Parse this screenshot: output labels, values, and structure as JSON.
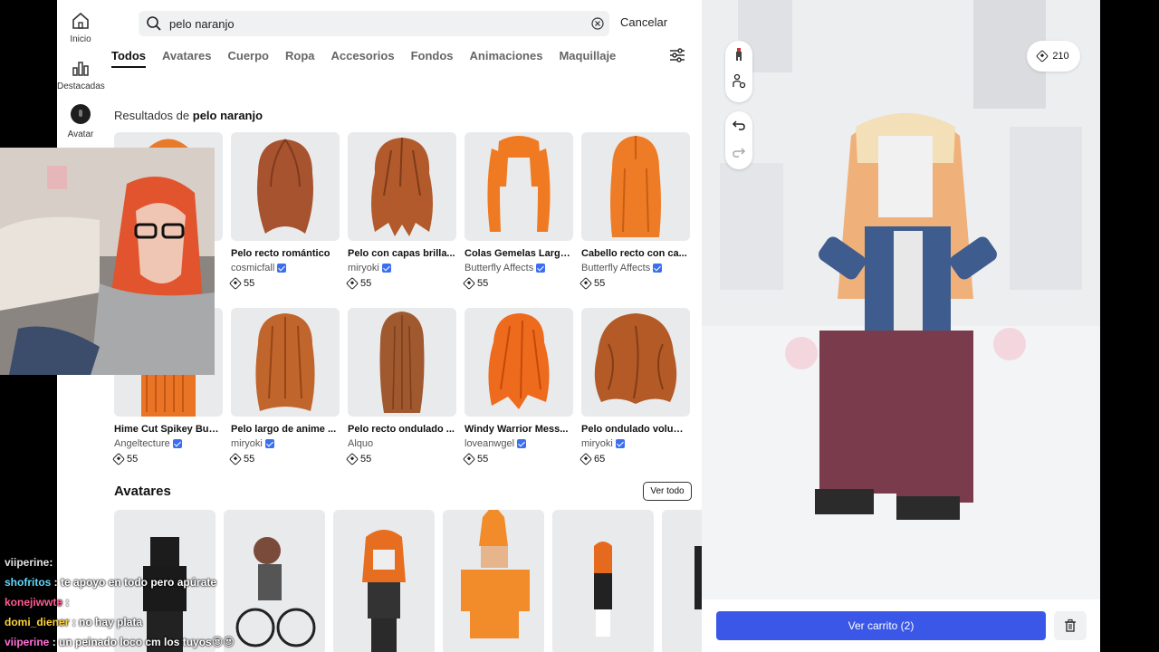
{
  "rail": {
    "items": [
      {
        "label": "Inicio",
        "icon": "home-icon"
      },
      {
        "label": "Destacadas",
        "icon": "chart-icon"
      },
      {
        "label": "Avatar",
        "icon": "avatar-icon"
      }
    ]
  },
  "search": {
    "value": "pelo naranjo",
    "cancel_label": "Cancelar"
  },
  "tabs": [
    "Todos",
    "Avatares",
    "Cuerpo",
    "Ropa",
    "Accesorios",
    "Fondos",
    "Animaciones",
    "Maquillaje"
  ],
  "active_tab": "Todos",
  "results": {
    "prefix": "Resultados de",
    "query": "pelo naranjo"
  },
  "items": [
    {
      "name": "",
      "creator": "",
      "price": ""
    },
    {
      "name": "Pelo recto romántico",
      "creator": "cosmicfall",
      "price": "55"
    },
    {
      "name": "Pelo con capas brilla...",
      "creator": "miryoki",
      "price": "55"
    },
    {
      "name": "Colas Gemelas Larga...",
      "creator": "Butterfly Affects",
      "price": "55"
    },
    {
      "name": "Cabello recto con ca...",
      "creator": "Butterfly Affects",
      "price": "55"
    },
    {
      "name": "Hime Cut Spikey Bun...",
      "creator": "Angeltecture",
      "price": "55"
    },
    {
      "name": "Pelo largo de anime ...",
      "creator": "miryoki",
      "price": "55"
    },
    {
      "name": "Pelo recto ondulado ...",
      "creator": "Alquo",
      "price": "55"
    },
    {
      "name": "Windy Warrior Mess...",
      "creator": "loveanwgel",
      "price": "55"
    },
    {
      "name": "Pelo ondulado volum...",
      "creator": "miryoki",
      "price": "65"
    }
  ],
  "avatars_section": {
    "title": "Avatares",
    "see_all": "Ver todo"
  },
  "chat": [
    {
      "user": "viiperine",
      "message": "",
      "color": "#e0e0e0"
    },
    {
      "user": "shofritos",
      "message": "te apoyo en todo pero apúrate",
      "color": "#5fd8ff"
    },
    {
      "user": "konejiwwte",
      "message": "",
      "color": "#ff5b8f"
    },
    {
      "user": "domi_diener",
      "message": "no hay plata",
      "color": "#ffd23a"
    },
    {
      "user": "viiperine",
      "message": "un peinado loco cm los tuyos😍😍",
      "color": "#ff6fd8"
    }
  ],
  "preview": {
    "balance": "210",
    "cart_label": "Ver carrito (2)"
  },
  "colors": {
    "accent": "#3a57e8",
    "hair_orange": "#e87a2c",
    "verified": "#3b6ff2"
  }
}
